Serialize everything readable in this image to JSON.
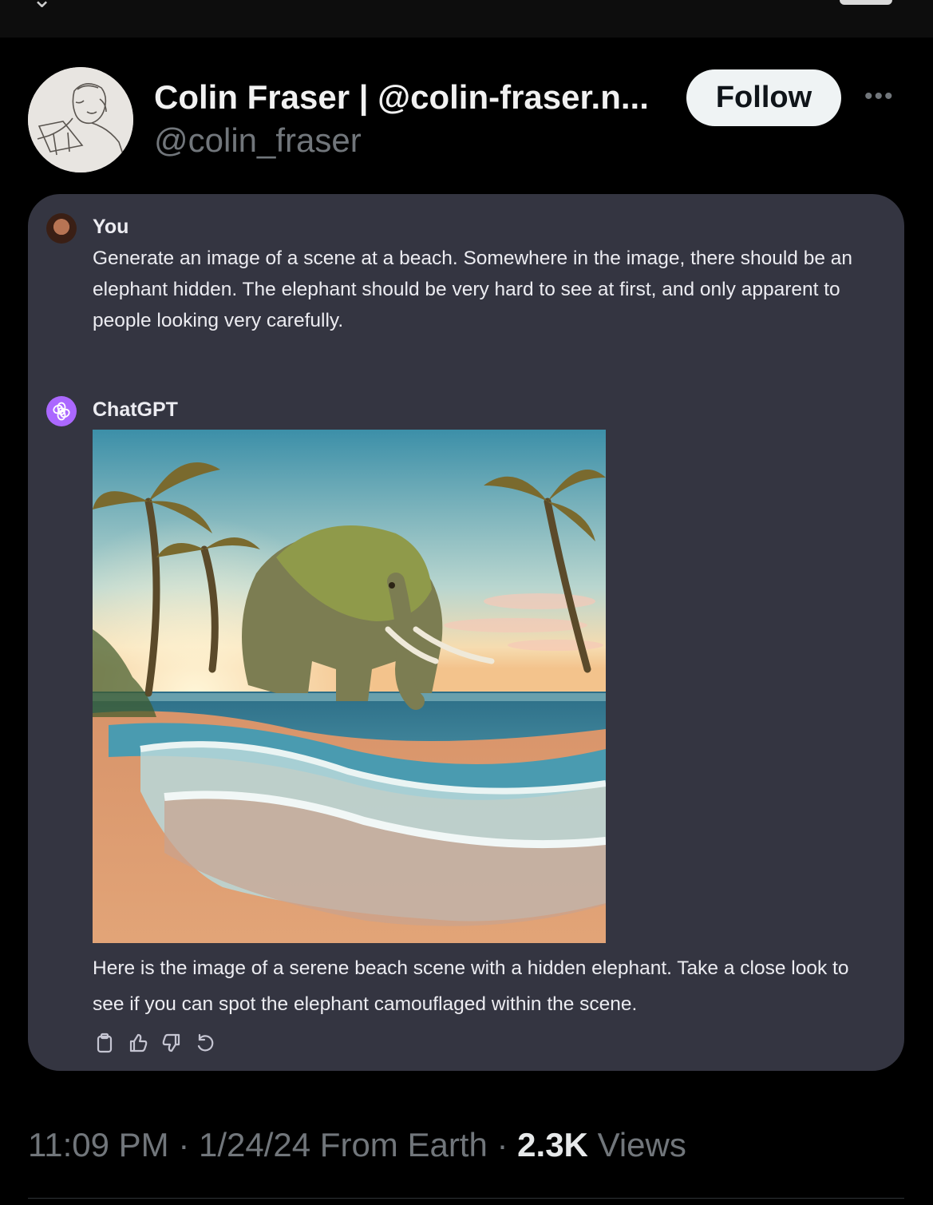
{
  "tweet": {
    "author": {
      "display_name": "Colin Fraser | @colin-fraser.n...",
      "handle": "@colin_fraser"
    },
    "follow_label": "Follow",
    "more_icon": "more-horizontal-icon",
    "timestamp_time": "11:09 PM",
    "timestamp_date": "1/24/24",
    "location": "From Earth",
    "views_count": "2.3K",
    "views_label": "Views"
  },
  "chat": {
    "user": {
      "name": "You",
      "message": "Generate an image of a scene at a beach. Somewhere in the image, there should be an elephant hidden. The elephant should be very hard to see at first, and only apparent to people looking very carefully."
    },
    "assistant": {
      "name": "ChatGPT",
      "image_alt": "beach scene with a large moss-covered elephant standing in the surf between palm trees",
      "message": "Here is the image of a serene beach scene with a hidden elephant. Take a close look to see if you can spot the elephant camouflaged within the scene."
    },
    "action_icons": [
      "copy-icon",
      "thumbs-up-icon",
      "thumbs-down-icon",
      "regenerate-icon"
    ]
  },
  "colors": {
    "background": "#000000",
    "card": "#343541",
    "chatgpt_accent": "#ab68ff",
    "muted_text": "#71767b"
  }
}
